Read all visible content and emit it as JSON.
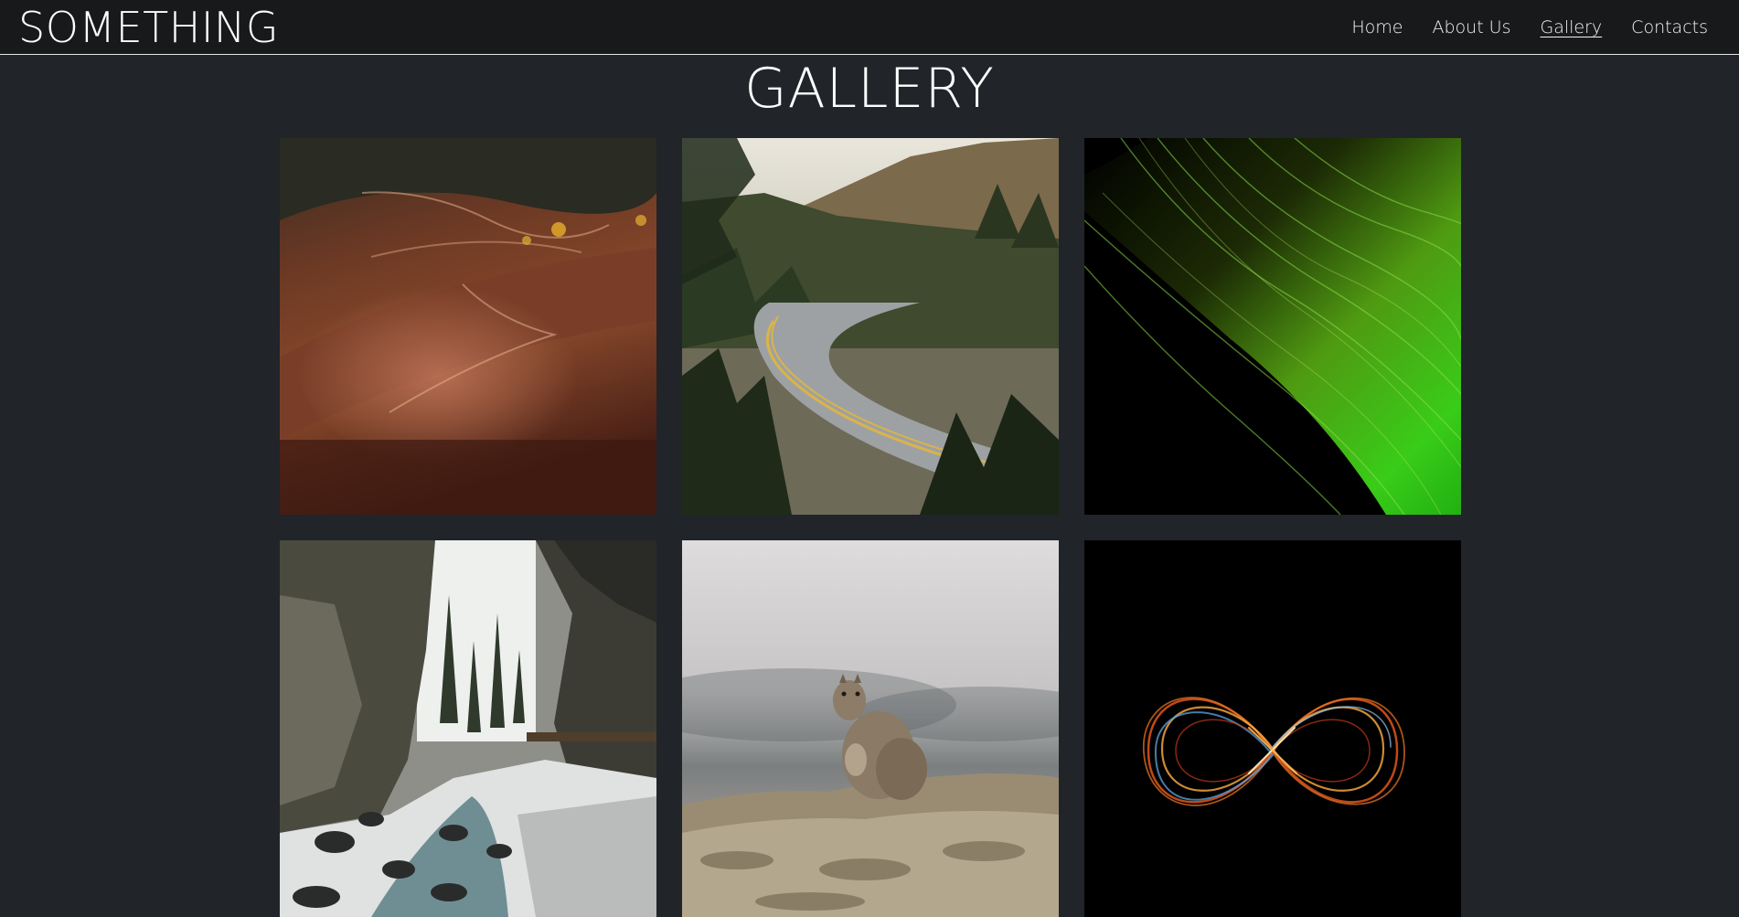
{
  "brand": "SOMETHING",
  "nav": {
    "items": [
      "Home",
      "About Us",
      "Gallery",
      "Contacts"
    ],
    "active": "Gallery"
  },
  "page": {
    "title": "GALLERY"
  },
  "colors": {
    "background": "#212429",
    "navbar": "#18191b",
    "text": "#ffffff"
  },
  "gallery": {
    "photos": [
      {
        "subject": "autumn-forest-hills"
      },
      {
        "subject": "mountain-road"
      },
      {
        "subject": "green-light-waves"
      },
      {
        "subject": "snowy-canyon-river"
      },
      {
        "subject": "squirrel-on-rock"
      },
      {
        "subject": "infinity-light-trail"
      }
    ]
  }
}
